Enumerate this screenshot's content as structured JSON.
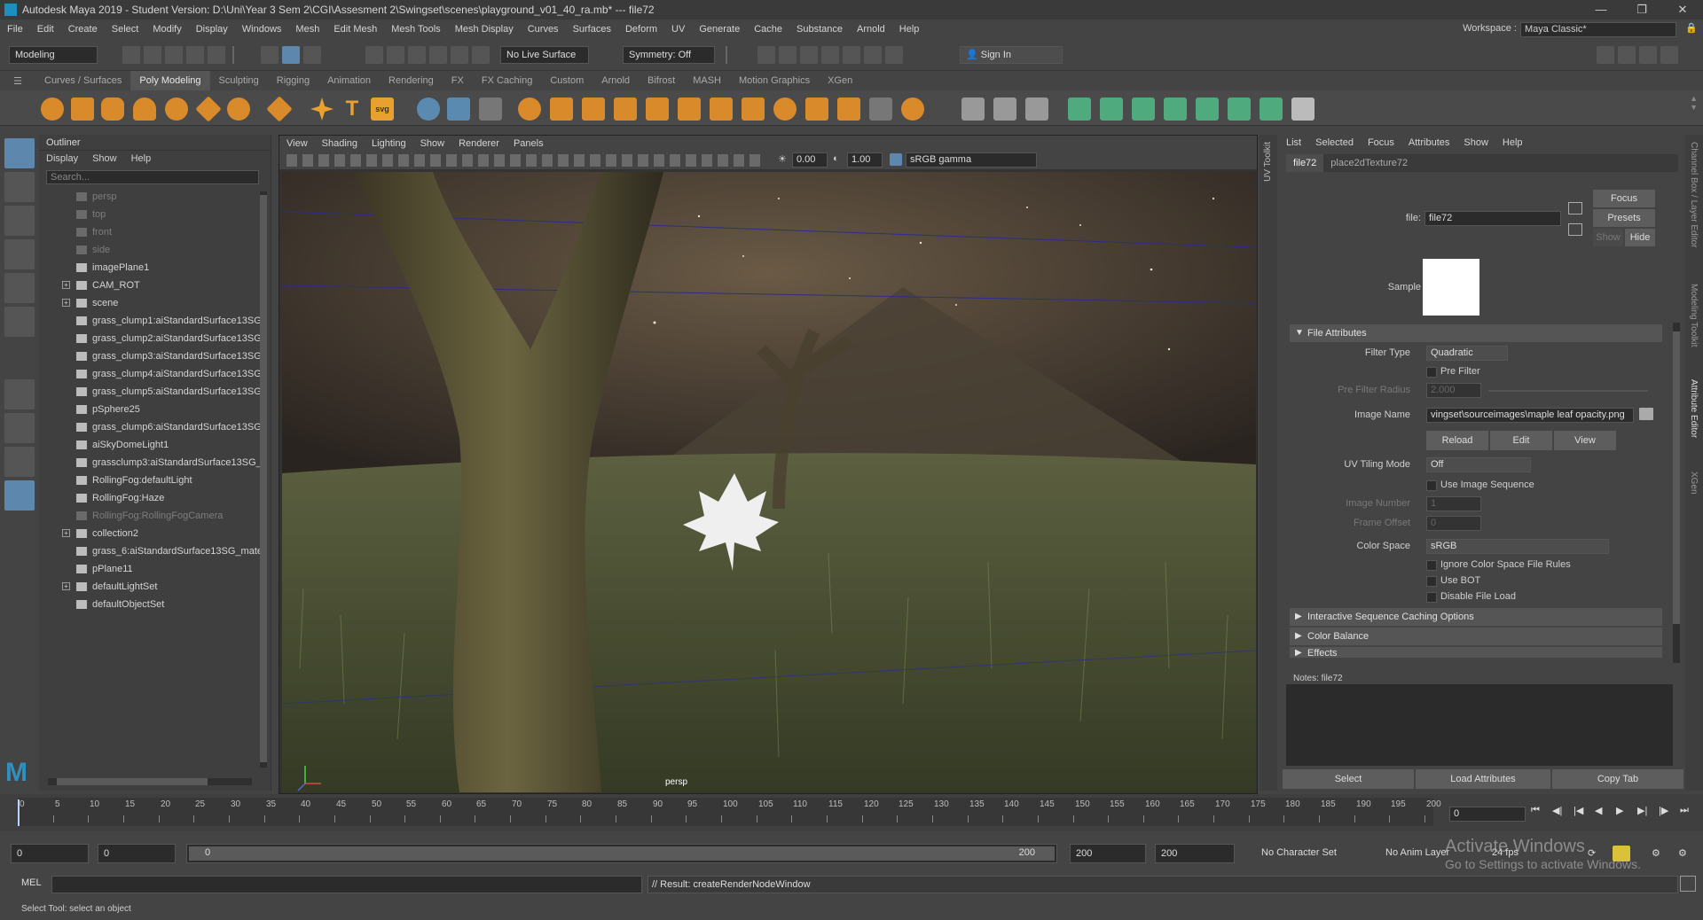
{
  "window": {
    "title": "Autodesk Maya 2019 - Student Version: D:\\Uni\\Year 3 Sem 2\\CGI\\Assesment 2\\Swingset\\scenes\\playground_v01_40_ra.mb*   ---   file72"
  },
  "menubar": {
    "items": [
      "File",
      "Edit",
      "Create",
      "Select",
      "Modify",
      "Display",
      "Windows",
      "Mesh",
      "Edit Mesh",
      "Mesh Tools",
      "Mesh Display",
      "Curves",
      "Surfaces",
      "Deform",
      "UV",
      "Generate",
      "Cache",
      "Substance",
      "Arnold",
      "Help"
    ],
    "workspace_label": "Workspace :",
    "workspace_value": "Maya Classic*"
  },
  "statusline": {
    "mode": "Modeling",
    "live_surface": "No Live Surface",
    "symmetry": "Symmetry: Off",
    "sign_in": "Sign In"
  },
  "shelf": {
    "tabs": [
      "Curves / Surfaces",
      "Poly Modeling",
      "Sculpting",
      "Rigging",
      "Animation",
      "Rendering",
      "FX",
      "FX Caching",
      "Custom",
      "Arnold",
      "Bifrost",
      "MASH",
      "Motion Graphics",
      "XGen"
    ],
    "active_tab": "Poly Modeling"
  },
  "outliner": {
    "title": "Outliner",
    "menu": [
      "Display",
      "Show",
      "Help"
    ],
    "search_placeholder": "Search...",
    "items": [
      {
        "label": "persp",
        "dim": true
      },
      {
        "label": "top",
        "dim": true
      },
      {
        "label": "front",
        "dim": true
      },
      {
        "label": "side",
        "dim": true
      },
      {
        "label": "imagePlane1",
        "dim": false
      },
      {
        "label": "CAM_ROT",
        "dim": false,
        "expand": true
      },
      {
        "label": "scene",
        "dim": false,
        "expand": true
      },
      {
        "label": "grass_clump1:aiStandardSurface13SG",
        "dim": false
      },
      {
        "label": "grass_clump2:aiStandardSurface13SG",
        "dim": false
      },
      {
        "label": "grass_clump3:aiStandardSurface13SG",
        "dim": false
      },
      {
        "label": "grass_clump4:aiStandardSurface13SG",
        "dim": false
      },
      {
        "label": "grass_clump5:aiStandardSurface13SG",
        "dim": false
      },
      {
        "label": "pSphere25",
        "dim": false
      },
      {
        "label": "grass_clump6:aiStandardSurface13SG",
        "dim": false
      },
      {
        "label": "aiSkyDomeLight1",
        "dim": false
      },
      {
        "label": "grassclump3:aiStandardSurface13SG_",
        "dim": false
      },
      {
        "label": "RollingFog:defaultLight",
        "dim": false
      },
      {
        "label": "RollingFog:Haze",
        "dim": false
      },
      {
        "label": "RollingFog:RollingFogCamera",
        "dim": true
      },
      {
        "label": "collection2",
        "dim": false,
        "expand": true
      },
      {
        "label": "grass_6:aiStandardSurface13SG_mate",
        "dim": false
      },
      {
        "label": "pPlane11",
        "dim": false
      },
      {
        "label": "defaultLightSet",
        "dim": false,
        "expand": true
      },
      {
        "label": "defaultObjectSet",
        "dim": false
      }
    ]
  },
  "viewport": {
    "menu": [
      "View",
      "Shading",
      "Lighting",
      "Show",
      "Renderer",
      "Panels"
    ],
    "exposure": "0.00",
    "gamma": "1.00",
    "color_space": "sRGB gamma",
    "camera_label": "persp"
  },
  "side_tabs": {
    "uv_toolkit": "UV Toolkit",
    "channel_box": "Channel Box / Layer Editor",
    "modeling_toolkit": "Modeling Toolkit",
    "attribute_editor": "Attribute Editor",
    "xgen": "XGen"
  },
  "attribute_editor": {
    "menu": [
      "List",
      "Selected",
      "Focus",
      "Attributes",
      "Show",
      "Help"
    ],
    "tabs": [
      "file72",
      "place2dTexture72"
    ],
    "file_label": "file:",
    "file_value": "file72",
    "focus_btn": "Focus",
    "presets_btn": "Presets",
    "show_btn": "Show",
    "hide_btn": "Hide",
    "sample_label": "Sample",
    "section_file_attributes": "File Attributes",
    "filter_type_label": "Filter Type",
    "filter_type_value": "Quadratic",
    "pre_filter_label": "Pre Filter",
    "pre_filter_radius_label": "Pre Filter Radius",
    "pre_filter_radius_value": "2.000",
    "image_name_label": "Image Name",
    "image_name_value": "vingset\\sourceimages\\maple leaf opacity.png",
    "reload_btn": "Reload",
    "edit_btn": "Edit",
    "view_btn": "View",
    "uv_tiling_label": "UV Tiling Mode",
    "uv_tiling_value": "Off",
    "use_image_sequence": "Use Image Sequence",
    "image_number_label": "Image Number",
    "image_number_value": "1",
    "frame_offset_label": "Frame Offset",
    "frame_offset_value": "0",
    "color_space_label": "Color Space",
    "color_space_value": "sRGB",
    "ignore_cs_rules": "Ignore Color Space File Rules",
    "use_bot": "Use BOT",
    "disable_file_load": "Disable File Load",
    "section_interactive": "Interactive Sequence Caching Options",
    "section_color_balance": "Color Balance",
    "section_effects": "Effects",
    "notes_label": "Notes:  file72",
    "select_btn": "Select",
    "load_attributes_btn": "Load Attributes",
    "copy_tab_btn": "Copy Tab"
  },
  "timeslider": {
    "ticks": [
      "0",
      "5",
      "10",
      "15",
      "20",
      "25",
      "30",
      "35",
      "40",
      "45",
      "50",
      "55",
      "60",
      "65",
      "70",
      "75",
      "80",
      "85",
      "90",
      "95",
      "100",
      "105",
      "110",
      "115",
      "120",
      "125",
      "130",
      "135",
      "140",
      "145",
      "150",
      "155",
      "160",
      "165",
      "170",
      "175",
      "180",
      "185",
      "190",
      "195",
      "200"
    ],
    "current_frame": "0"
  },
  "rangeslider": {
    "start": "0",
    "anim_start": "0",
    "range_start": "0",
    "range_end": "200",
    "anim_end": "200",
    "end": "200",
    "character_set": "No Character Set",
    "anim_layer": "No Anim Layer",
    "fps": "24 fps"
  },
  "cmdline": {
    "lang": "MEL",
    "result": "// Result: createRenderNodeWindow"
  },
  "helpline": "Select Tool: select an object",
  "watermark": {
    "line1": "Activate Windows",
    "line2": "Go to Settings to activate Windows."
  },
  "colors": {
    "accent": "#5d87ad",
    "panel": "#444444",
    "field": "#2b2b2b"
  }
}
